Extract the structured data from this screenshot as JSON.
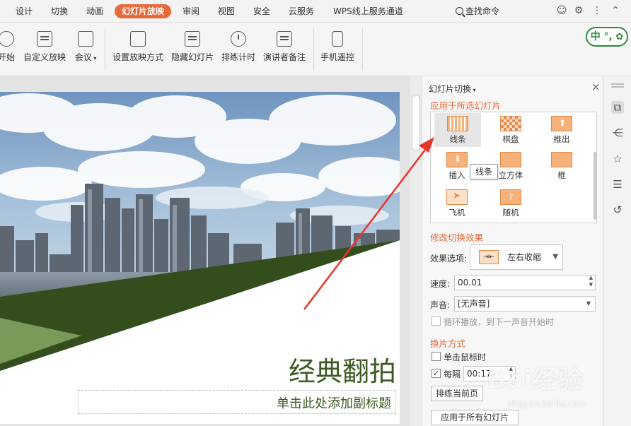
{
  "menu_tabs": [
    "设计",
    "切换",
    "动画",
    "幻灯片放映",
    "审阅",
    "视图",
    "安全",
    "云服务",
    "WPS线上服务通道"
  ],
  "active_tab": "幻灯片放映",
  "search_label": "查找命令",
  "ribbon": {
    "from_start": "开始",
    "custom_show": "自定义放映",
    "meeting": "会议",
    "setup_show": "设置放映方式",
    "hide_slide": "隐藏幻灯片",
    "rehearse": "排练计时",
    "presenter_notes": "演讲者备注",
    "phone_remote": "手机遥控"
  },
  "ime_indicator": "中 °,",
  "slide": {
    "title": "经典翻拍",
    "subtitle": "单击此处添加副标题"
  },
  "panel": {
    "header": "幻灯片切换",
    "apply_selected_heading": "应用于所选幻灯片",
    "effects": [
      "线条",
      "棋盘",
      "推出",
      "插入",
      "立方体",
      "框",
      "飞机",
      "随机"
    ],
    "selected_effect": "线条",
    "tooltip": "线条",
    "modify_heading": "修改切换效果",
    "effect_option_label": "效果选项:",
    "effect_option_value": "左右收缩",
    "speed_label": "速度:",
    "speed_value": "00.01",
    "sound_label": "声音:",
    "sound_value": "[无声音]",
    "loop_label": "循环播放，到下一声音开始时",
    "advance_heading": "换片方式",
    "on_click_label": "单击鼠标时",
    "every_label": "每隔",
    "every_value": "00:17",
    "play_current_button": "排练当前页",
    "apply_all_button": "应用于所有幻灯片"
  },
  "watermark": {
    "brand": "Bai经验",
    "url": "jingyan.baidu.com"
  },
  "colors": {
    "accent": "#e8693a",
    "slide_green_dark": "#344d1d",
    "slide_green_light": "#7a9a5a",
    "arrow_red": "#e8352a"
  }
}
